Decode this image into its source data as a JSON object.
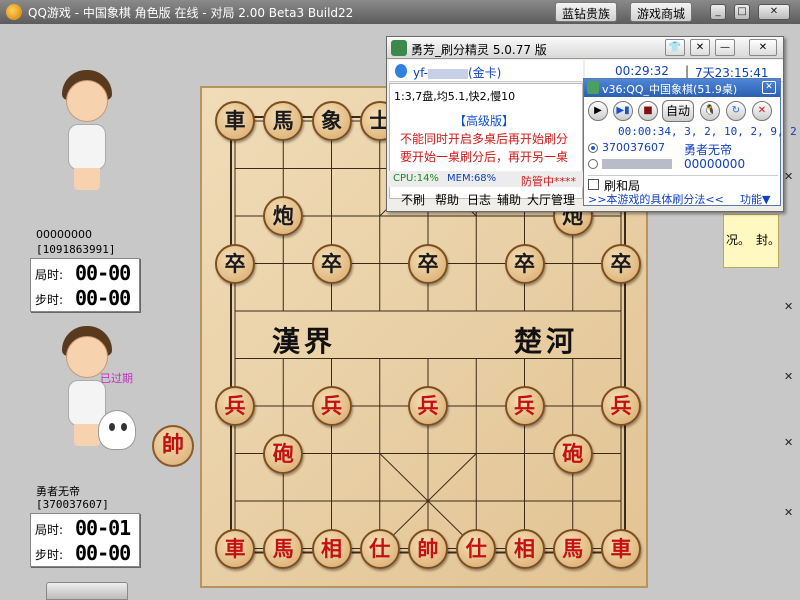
{
  "window": {
    "title": "QQ游戏 - 中国象棋 角色版 在线 - 对局 2.00  Beta3  Build22",
    "btn_diamond": "蓝钻贵族",
    "btn_mall": "游戏商城"
  },
  "players": [
    {
      "name": "00000000",
      "id": "[1091863991]",
      "game_time_label": "局时:",
      "game_time": "00-00",
      "step_time_label": "步时:",
      "step_time": "00-00"
    },
    {
      "name": "勇者无帝",
      "id": "[370037607]",
      "game_time_label": "局时:",
      "game_time": "00-01",
      "step_time_label": "步时:",
      "step_time": "00-00",
      "status": "已过期"
    }
  ],
  "side_piece": "帥",
  "river": {
    "left": "漢界",
    "right": "楚河"
  },
  "pieces": [
    {
      "c": "車",
      "col": 0,
      "row": 0,
      "side": "black"
    },
    {
      "c": "馬",
      "col": 1,
      "row": 0,
      "side": "black"
    },
    {
      "c": "象",
      "col": 2,
      "row": 0,
      "side": "black"
    },
    {
      "c": "士",
      "col": 3,
      "row": 0,
      "side": "black"
    },
    {
      "c": "炮",
      "col": 1,
      "row": 2,
      "side": "black"
    },
    {
      "c": "炮",
      "col": 7,
      "row": 2,
      "side": "black"
    },
    {
      "c": "卒",
      "col": 0,
      "row": 3,
      "side": "black"
    },
    {
      "c": "卒",
      "col": 2,
      "row": 3,
      "side": "black"
    },
    {
      "c": "卒",
      "col": 4,
      "row": 3,
      "side": "black"
    },
    {
      "c": "卒",
      "col": 6,
      "row": 3,
      "side": "black"
    },
    {
      "c": "卒",
      "col": 8,
      "row": 3,
      "side": "black"
    },
    {
      "c": "兵",
      "col": 0,
      "row": 6,
      "side": "red"
    },
    {
      "c": "兵",
      "col": 2,
      "row": 6,
      "side": "red"
    },
    {
      "c": "兵",
      "col": 4,
      "row": 6,
      "side": "red"
    },
    {
      "c": "兵",
      "col": 6,
      "row": 6,
      "side": "red"
    },
    {
      "c": "兵",
      "col": 8,
      "row": 6,
      "side": "red"
    },
    {
      "c": "砲",
      "col": 1,
      "row": 7,
      "side": "red"
    },
    {
      "c": "砲",
      "col": 7,
      "row": 7,
      "side": "red"
    },
    {
      "c": "車",
      "col": 0,
      "row": 9,
      "side": "red"
    },
    {
      "c": "馬",
      "col": 1,
      "row": 9,
      "side": "red"
    },
    {
      "c": "相",
      "col": 2,
      "row": 9,
      "side": "red"
    },
    {
      "c": "仕",
      "col": 3,
      "row": 9,
      "side": "red"
    },
    {
      "c": "帥",
      "col": 4,
      "row": 9,
      "side": "red"
    },
    {
      "c": "仕",
      "col": 5,
      "row": 9,
      "side": "red"
    },
    {
      "c": "相",
      "col": 6,
      "row": 9,
      "side": "red"
    },
    {
      "c": "馬",
      "col": 7,
      "row": 9,
      "side": "red"
    },
    {
      "c": "車",
      "col": 8,
      "row": 9,
      "side": "red"
    }
  ],
  "note": {
    "t1": "况。",
    "t2": "封。"
  },
  "helper": {
    "title": "勇芳_刷分精灵 5.0.77 版",
    "account": "yf-",
    "account_suffix": "(金卡)",
    "timer1": "00:29:32",
    "timer2": "7天23:15:41",
    "stats": "1:3,7盘,均5.1,快2,慢10",
    "edition": "【高级版】",
    "line1": "不能同时开启多桌后再开始刷分",
    "line2": "要开始一桌刷分后，再开另一桌",
    "cpu": "CPU:14%",
    "mem": "MEM:68%",
    "guard": "防管中****",
    "menu": [
      "不刷",
      "帮助",
      "日志",
      "辅助",
      "大厅管理"
    ]
  },
  "game_panel": {
    "title": "v36:QQ_中国象棋(51.9桌)",
    "auto_label": "自动",
    "progress": "00:00:34, 3, 2, 10, 2, 9, 2",
    "user1_id": "370037607",
    "user1_name": "勇者无帝",
    "user2_score": "00000000",
    "checkbox_label": "刷和局",
    "method_link": ">>本游戏的具体刷分法<<",
    "func_label": "功能▼"
  },
  "colors": {
    "red_piece": "#c41010",
    "black_piece": "#1a1a1a",
    "board": "#e8cda0",
    "link": "#1040c0"
  }
}
